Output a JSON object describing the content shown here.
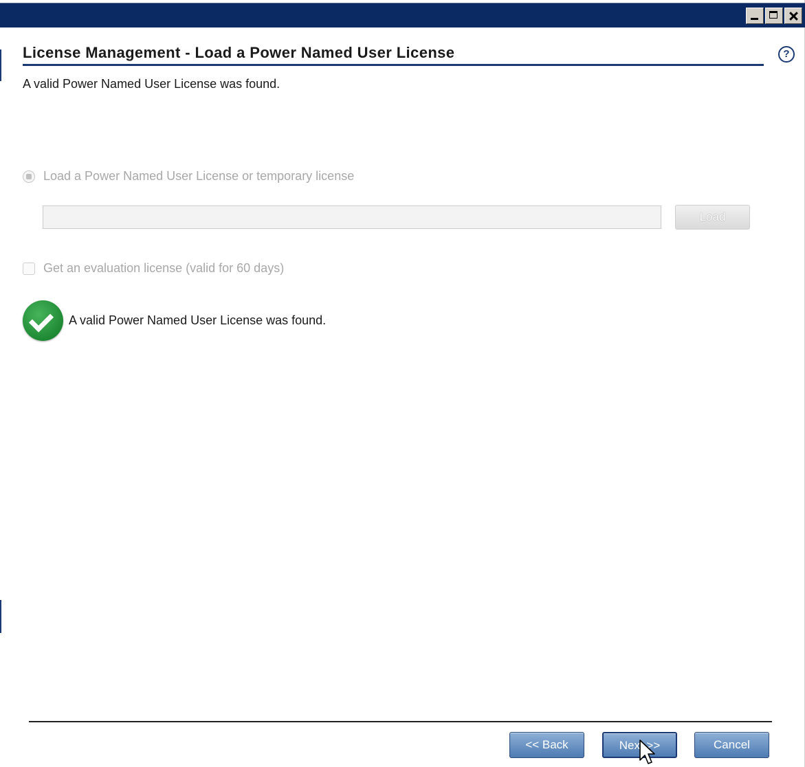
{
  "window": {
    "controls": {
      "minimize": "minimize-icon",
      "maximize": "maximize-icon",
      "close": "close-icon"
    }
  },
  "header": {
    "title": "License Management - Load a Power Named User License",
    "help_icon": "question-mark-icon",
    "help_glyph": "?"
  },
  "subtitle": "A valid Power Named User License was found.",
  "options": {
    "load_license_label": "Load a Power Named User License or temporary license",
    "license_path_value": "",
    "load_button_label": "Load",
    "evaluation_label": "Get an evaluation license (valid for 60 days)"
  },
  "status": {
    "icon": "checkmark-circle-icon",
    "message": "A valid Power Named User License was found."
  },
  "footer": {
    "back_label": "<< Back",
    "next_label": "Next >>",
    "cancel_label": "Cancel"
  },
  "colors": {
    "titlebar": "#0b2a63",
    "accent": "#1b3a74",
    "success": "#1f8a34",
    "button": "#4d7bb3"
  }
}
